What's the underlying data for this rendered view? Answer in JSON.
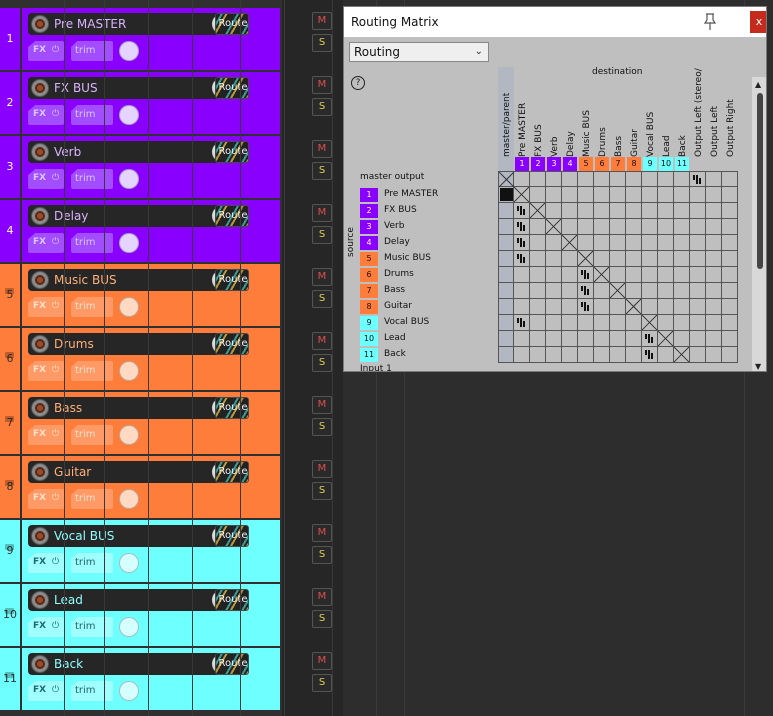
{
  "colors": {
    "purple": "#8a00ff",
    "orange": "#ff7d3a",
    "cyan": "#6effff"
  },
  "icons": {
    "record_arm": "record-arm-icon",
    "volume": "volume-knob-icon",
    "pan": "pan-knob-icon",
    "fx_power": "power-icon",
    "trim_env": "envelope-icon",
    "pin": "pin-icon",
    "close": "close-icon",
    "help": "help-icon",
    "folder": "folder-icon"
  },
  "tracks": [
    {
      "num": "1",
      "name": "Pre MASTER",
      "color": "purple"
    },
    {
      "num": "2",
      "name": "FX BUS",
      "color": "purple"
    },
    {
      "num": "3",
      "name": "Verb",
      "color": "purple"
    },
    {
      "num": "4",
      "name": "Delay",
      "color": "purple"
    },
    {
      "num": "5",
      "name": "Music BUS",
      "color": "orange"
    },
    {
      "num": "6",
      "name": "Drums",
      "color": "orange"
    },
    {
      "num": "7",
      "name": "Bass",
      "color": "orange"
    },
    {
      "num": "8",
      "name": "Guitar",
      "color": "orange"
    },
    {
      "num": "9",
      "name": "Vocal BUS",
      "color": "cyan"
    },
    {
      "num": "10",
      "name": "Lead",
      "color": "cyan"
    },
    {
      "num": "11",
      "name": "Back",
      "color": "cyan"
    }
  ],
  "track_buttons": {
    "route": "Route",
    "fx": "FX",
    "fx_power": "⏻",
    "trim": "trim",
    "mute": "M",
    "solo": "S"
  },
  "matrix": {
    "title": "Routing Matrix",
    "close": "x",
    "pin": "⚲",
    "mode": "Routing",
    "mode_chevron": "⌄",
    "help": "?",
    "destination_label": "destination",
    "source_label": "source",
    "master_output": "master output",
    "input_label": "Input 1",
    "scroll_up": "▲",
    "scroll_down": "▼",
    "dest_columns": [
      {
        "name": "master/parent",
        "num": "",
        "color": ""
      },
      {
        "name": "Pre MASTER",
        "num": "1",
        "color": "purple"
      },
      {
        "name": "FX BUS",
        "num": "2",
        "color": "purple"
      },
      {
        "name": "Verb",
        "num": "3",
        "color": "purple"
      },
      {
        "name": "Delay",
        "num": "4",
        "color": "purple"
      },
      {
        "name": "Music BUS",
        "num": "5",
        "color": "orange"
      },
      {
        "name": "Drums",
        "num": "6",
        "color": "orange"
      },
      {
        "name": "Bass",
        "num": "7",
        "color": "orange"
      },
      {
        "name": "Guitar",
        "num": "8",
        "color": "orange"
      },
      {
        "name": "Vocal BUS",
        "num": "9",
        "color": "cyan"
      },
      {
        "name": "Lead",
        "num": "10",
        "color": "cyan"
      },
      {
        "name": "Back",
        "num": "11",
        "color": "cyan"
      },
      {
        "name": "Output Left (stereo/",
        "num": "",
        "color": ""
      },
      {
        "name": "Output Left",
        "num": "",
        "color": ""
      },
      {
        "name": "Output Right",
        "num": "",
        "color": ""
      }
    ],
    "grid": [
      [
        "x",
        "",
        "",
        "",
        "",
        "",
        "",
        "",
        "",
        "",
        "",
        "",
        "send",
        "",
        ""
      ],
      [
        "filled",
        "x",
        "",
        "",
        "",
        "",
        "",
        "",
        "",
        "",
        "",
        "",
        "",
        "",
        ""
      ],
      [
        "",
        "send",
        "x",
        "",
        "",
        "",
        "",
        "",
        "",
        "",
        "",
        "",
        "",
        "",
        ""
      ],
      [
        "",
        "send",
        "",
        "x",
        "",
        "",
        "",
        "",
        "",
        "",
        "",
        "",
        "",
        "",
        ""
      ],
      [
        "",
        "send",
        "",
        "",
        "x",
        "",
        "",
        "",
        "",
        "",
        "",
        "",
        "",
        "",
        ""
      ],
      [
        "",
        "send",
        "",
        "",
        "",
        "x",
        "",
        "",
        "",
        "",
        "",
        "",
        "",
        "",
        ""
      ],
      [
        "",
        "",
        "",
        "",
        "",
        "send",
        "x",
        "",
        "",
        "",
        "",
        "",
        "",
        "",
        ""
      ],
      [
        "",
        "",
        "",
        "",
        "",
        "send",
        "",
        "x",
        "",
        "",
        "",
        "",
        "",
        "",
        ""
      ],
      [
        "",
        "",
        "",
        "",
        "",
        "send",
        "",
        "",
        "x",
        "",
        "",
        "",
        "",
        "",
        ""
      ],
      [
        "",
        "send",
        "",
        "",
        "",
        "",
        "",
        "",
        "",
        "x",
        "",
        "",
        "",
        "",
        ""
      ],
      [
        "",
        "",
        "",
        "",
        "",
        "",
        "",
        "",
        "",
        "send",
        "x",
        "",
        "",
        "",
        ""
      ],
      [
        "",
        "",
        "",
        "",
        "",
        "",
        "",
        "",
        "",
        "send",
        "",
        "x",
        "",
        "",
        ""
      ]
    ]
  }
}
